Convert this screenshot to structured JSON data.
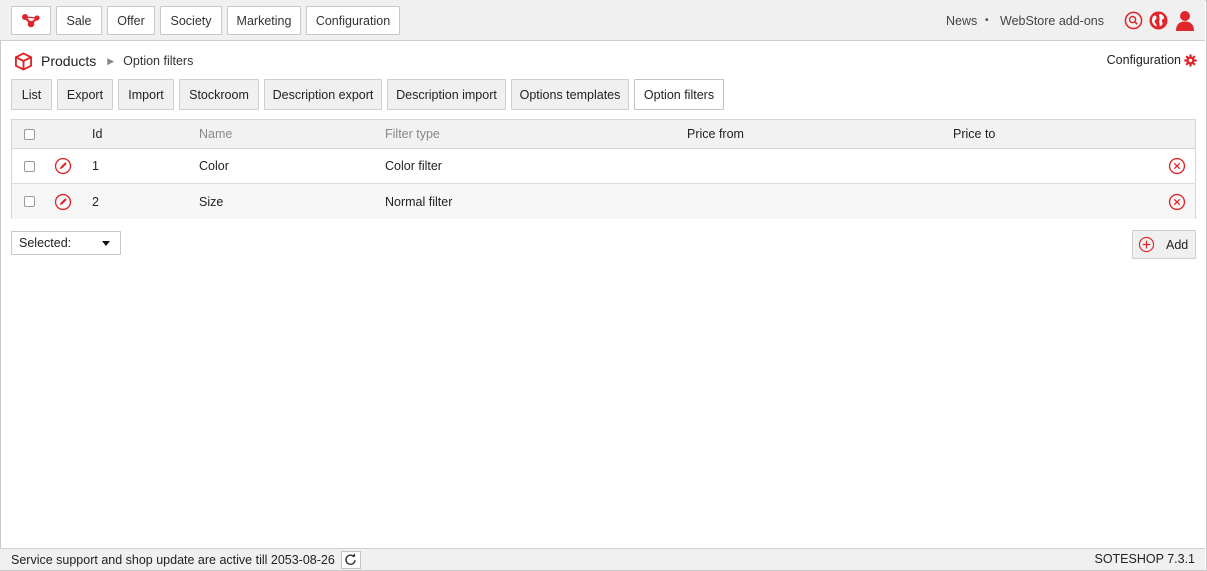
{
  "header": {
    "nav": [
      {
        "label": "Sale"
      },
      {
        "label": "Offer"
      },
      {
        "label": "Society"
      },
      {
        "label": "Marketing"
      },
      {
        "label": "Configuration"
      }
    ],
    "news": "News",
    "separator": "•",
    "addons": "WebStore add-ons"
  },
  "breadcrumb": {
    "title": "Products",
    "current": "Option filters"
  },
  "config_link": "Configuration",
  "subnav": [
    {
      "label": "List"
    },
    {
      "label": "Export"
    },
    {
      "label": "Import"
    },
    {
      "label": "Stockroom"
    },
    {
      "label": "Description export"
    },
    {
      "label": "Description import"
    },
    {
      "label": "Options templates"
    },
    {
      "label": "Option filters",
      "active": true
    }
  ],
  "table": {
    "columns": [
      "Id",
      "Name",
      "Filter type",
      "Price from",
      "Price to"
    ],
    "rows": [
      {
        "id": "1",
        "name": "Color",
        "filter_type": "Color filter",
        "price_from": "",
        "price_to": ""
      },
      {
        "id": "2",
        "name": "Size",
        "filter_type": "Normal filter",
        "price_from": "",
        "price_to": ""
      }
    ]
  },
  "bulk_select": {
    "value": "Selected:"
  },
  "add_button": "Add",
  "footer": {
    "support": "Service support and shop update are active till 2053-08-26",
    "version": "SOTESHOP 7.3.1"
  },
  "colors": {
    "accent": "#e0262b",
    "bar": "#f0f0f0"
  }
}
